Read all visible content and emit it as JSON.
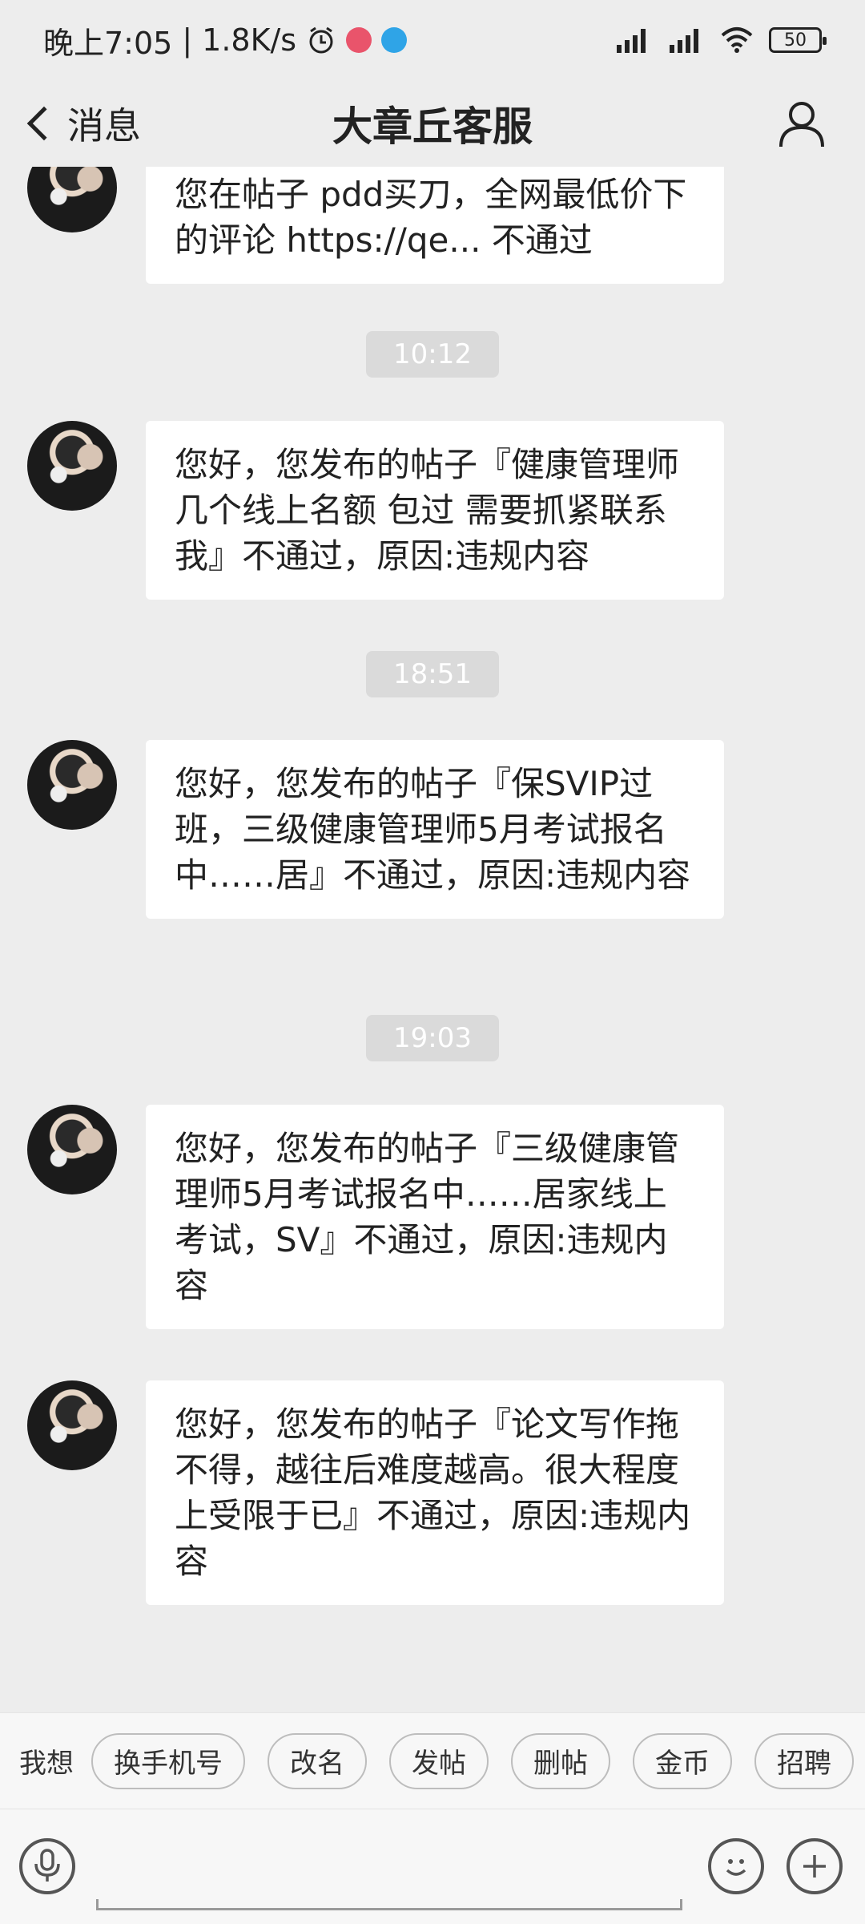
{
  "status_bar": {
    "time": "晚上7:05",
    "speed": "1.8K/s",
    "battery": "50"
  },
  "header": {
    "back_label": "消息",
    "title": "大章丘客服"
  },
  "messages": [
    {
      "text": "您在帖子 pdd买刀，全网最低价下的评论 https://qe... 不通过"
    },
    {
      "time": "10:12"
    },
    {
      "text": "您好，您发布的帖子『健康管理师 几个线上名额 包过 需要抓紧联系我』不通过，原因:违规内容"
    },
    {
      "time": "18:51"
    },
    {
      "text": "您好，您发布的帖子『保SVIP过班，三级健康管理师5月考试报名中……居』不通过，原因:违规内容"
    },
    {
      "time": "19:03"
    },
    {
      "text": "您好，您发布的帖子『三级健康管理师5月考试报名中……居家线上考试，SV』不通过，原因:违规内容"
    },
    {
      "text": "您好，您发布的帖子『论文写作拖不得，越往后难度越高。很大程度上受限于已』不通过，原因:违规内容"
    }
  ],
  "quick_bar": {
    "label": "我想",
    "chips": [
      "换手机号",
      "改名",
      "发帖",
      "删帖",
      "金币",
      "招聘"
    ]
  }
}
